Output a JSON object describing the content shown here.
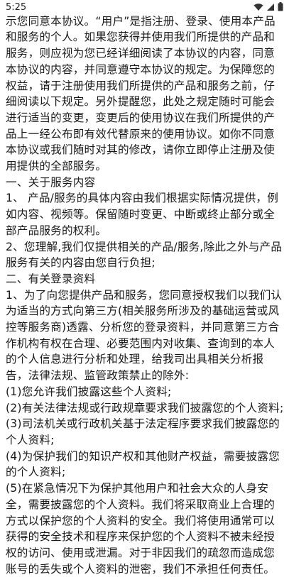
{
  "status_bar": {
    "time": "5:25",
    "icons": [
      "wifi-icon",
      "cellular-signal-icon",
      "battery-icon"
    ]
  },
  "agreement": {
    "paragraphs": [
      "品和服务，请仔细阅读本协议。您的注册及使用行为表示您同意本协议。“用户”是指注册、登录、使用本产品和服务的个人。如果您获得并使用我们所提供的产品和服务，则应视为您已经详细阅读了本协议的内容，同意本协议的内容，并同意遵守本协议的规定。为保障您的权益，请于注册使用我们所提供的产品和服务之前，仔细阅读以下规定。另外提醒您，此处之规定随时可能会进行适当的变更，变更后的使用协议在我们所提供的产品上一经公布即有效代替原来的使用协议。如你不同意本协议或我们随时对其的修改，请你立即停止注册及使用提供的全部服务。",
      "一、关于服务内容",
      "1、 产品/服务的具体内容由我们根据实际情况提供，例如内容、视频等。保留随时变更、中断或终止部分或全部产品服务的权利。",
      "2、您理解,我们仅提供相关的产品/服务,除此之外与产品服务有关的内容由您自行负担;",
      "二、有关登录资料",
      "1、为了向您提供产品和服务，您同意授权我们以我们认为适当的方式向第三方(相关服务所涉及的基础运营或风控等服务商)透露、分析您的登录资料，并同意第三方合作机构有权在合理、必要范围内对收集、查询到的本人的个人信息进行分析和处理，给我司出具相关分析报告，法律法规、监管政策禁止的除外:",
      "(1)您允许我们披露这些个人资料;",
      "(2)有关法律法规或行政规章要求我们披露您的个人资料;",
      "(3)司法机关或行政机关基于法定程序要求我们披露您的个人资料;",
      "(4)为保护我们的知识产权和其他财产权益，需要披露您的个人资料;",
      "(5)在紧急情况下为保护其他用户和社会大众的人身安全，需要披露您的个人资料。我们将采取商业上合理的方式以保护您的个人资料的安全。我们将使用通常可以获得的安全技术和程序来保护您的个人资料不被未经授权的访问、使用或泄漏。对于非因我们的疏忽而造成您账号的丢失或个人资料的泄密，我们不承担任何责任。"
    ]
  }
}
